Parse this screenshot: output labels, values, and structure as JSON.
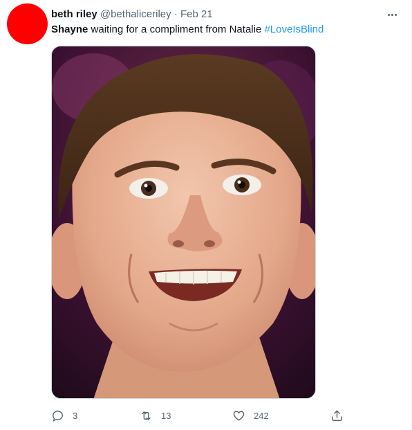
{
  "tweet": {
    "author": {
      "display_name": "beth riley",
      "handle": "@bethaliceriley",
      "separator": "·",
      "date": "Feb 21",
      "avatar_color": "#ff0000"
    },
    "text": {
      "name": "Shayne",
      "body": " waiting for a compliment from Natalie ",
      "hashtag": "#LoveIsBlind"
    },
    "media": {
      "description": "close-up photo of a grinning man with wide eyes"
    },
    "actions": {
      "replies": "3",
      "retweets": "13",
      "likes": "242"
    }
  },
  "colors": {
    "text": "#0f1419",
    "secondary": "#536471",
    "link": "#1d9bf0"
  }
}
